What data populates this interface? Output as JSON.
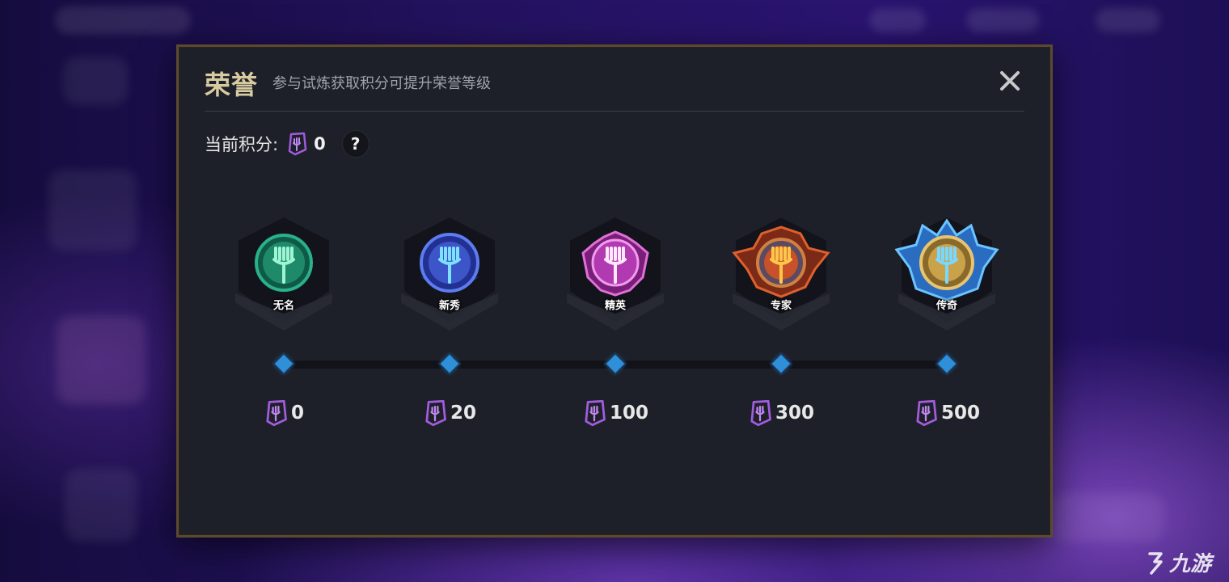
{
  "dialog": {
    "title": "荣誉",
    "subtitle": "参与试炼获取积分可提升荣誉等级",
    "close_icon": "close-icon"
  },
  "current": {
    "label": "当前积分:",
    "value": "0",
    "help_label": "?"
  },
  "ranks": [
    {
      "name": "无名",
      "threshold": "0",
      "color": "#1f8a6a"
    },
    {
      "name": "新秀",
      "threshold": "20",
      "color": "#3c55c8"
    },
    {
      "name": "精英",
      "threshold": "100",
      "color": "#b23ab0"
    },
    {
      "name": "专家",
      "threshold": "300",
      "color": "#c8512a"
    },
    {
      "name": "传奇",
      "threshold": "500",
      "color": "#c9a24a"
    }
  ],
  "watermark": "九游",
  "colors": {
    "accent_token": "#a35ce0",
    "node": "#2f8fd8",
    "title": "#d8cba0"
  }
}
